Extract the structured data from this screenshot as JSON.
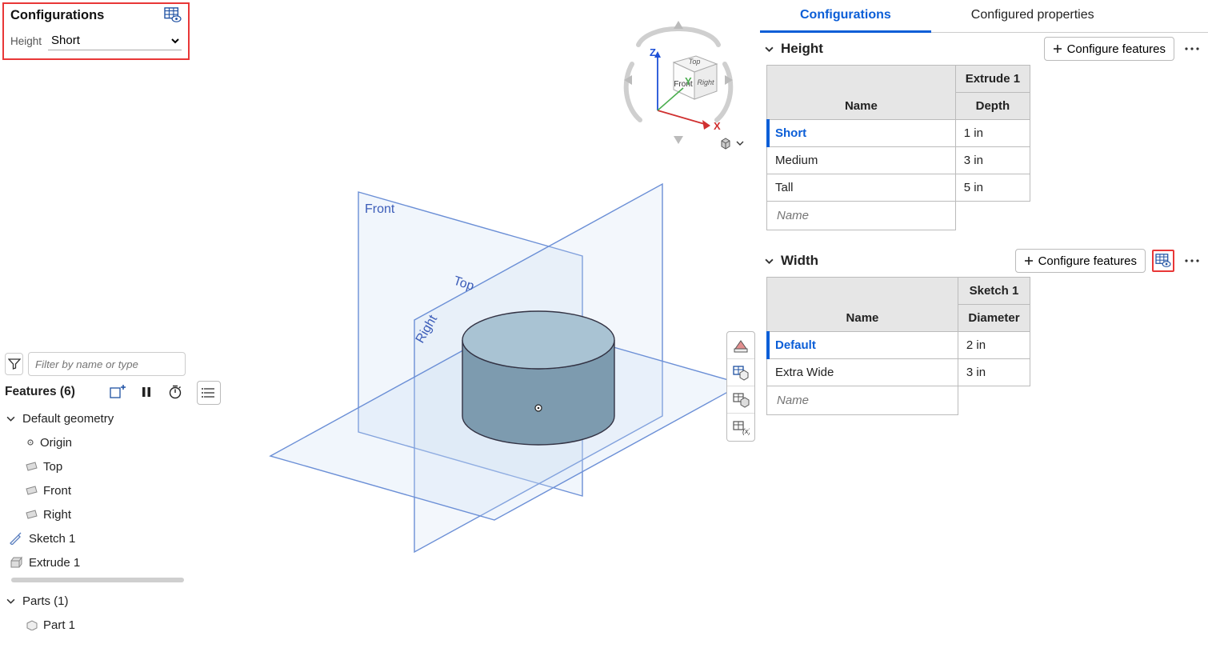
{
  "topConfigBox": {
    "title": "Configurations",
    "rowLabel": "Height",
    "selectedValue": "Short"
  },
  "featuresPanel": {
    "filterPlaceholder": "Filter by name or type",
    "title": "Features (6)",
    "tree": {
      "defaultGeometry": "Default geometry",
      "origin": "Origin",
      "top": "Top",
      "front": "Front",
      "right": "Right",
      "sketch1": "Sketch 1",
      "extrude1": "Extrude 1",
      "partsHeader": "Parts (1)",
      "part1": "Part 1"
    }
  },
  "viewportLabels": {
    "front": "Front",
    "top": "Top",
    "right": "Right"
  },
  "triad": {
    "z": "Z",
    "y": "Y",
    "x": "X",
    "cubeFront": "Front",
    "cubeTop": "Top",
    "cubeRight": "Right"
  },
  "rightPanel": {
    "tabs": {
      "configurations": "Configurations",
      "configuredProps": "Configured properties"
    },
    "configureFeaturesBtn": "Configure features",
    "heightSection": {
      "title": "Height",
      "featureHeader": "Extrude 1",
      "nameHeader": "Name",
      "paramHeader": "Depth",
      "rows": [
        {
          "name": "Short",
          "value": "1 in",
          "active": true
        },
        {
          "name": "Medium",
          "value": "3 in",
          "active": false
        },
        {
          "name": "Tall",
          "value": "5 in",
          "active": false
        }
      ],
      "newRowPlaceholder": "Name"
    },
    "widthSection": {
      "title": "Width",
      "featureHeader": "Sketch 1",
      "nameHeader": "Name",
      "paramHeader": "Diameter",
      "rows": [
        {
          "name": "Default",
          "value": "2 in",
          "active": true
        },
        {
          "name": "Extra Wide",
          "value": "3 in",
          "active": false
        }
      ],
      "newRowPlaceholder": "Name"
    }
  }
}
